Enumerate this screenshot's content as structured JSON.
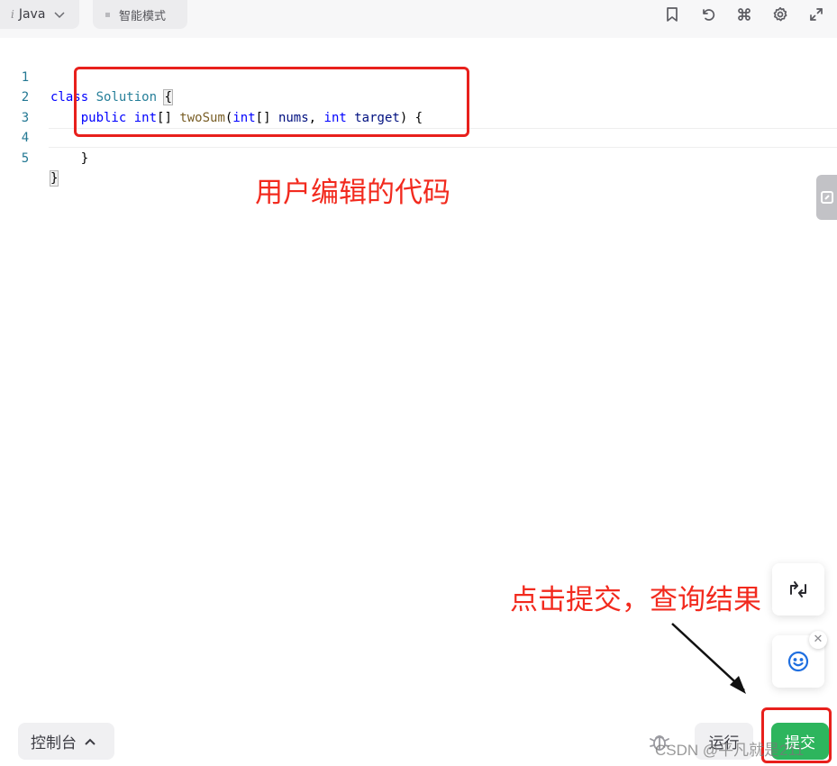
{
  "toolbar": {
    "language_icon": "i",
    "language": "Java",
    "mode": "智能模式",
    "icons": [
      "bookmark-icon",
      "reset-icon",
      "command-icon",
      "settings-icon",
      "fullscreen-icon"
    ]
  },
  "editor": {
    "lines": [
      {
        "number": "1",
        "tokens": [
          [
            "kw",
            "class"
          ],
          [
            "pl",
            " "
          ],
          [
            "ty",
            "Solution"
          ],
          [
            "pl",
            " "
          ],
          [
            "br",
            "{"
          ]
        ]
      },
      {
        "number": "2",
        "tokens": [
          [
            "pl",
            "    "
          ],
          [
            "kw",
            "public"
          ],
          [
            "pl",
            " "
          ],
          [
            "kw",
            "int"
          ],
          [
            "pl",
            "[] "
          ],
          [
            "fn",
            "twoSum"
          ],
          [
            "pl",
            "("
          ],
          [
            "kw",
            "int"
          ],
          [
            "pl",
            "[] "
          ],
          [
            "vr",
            "nums"
          ],
          [
            "pl",
            ", "
          ],
          [
            "kw",
            "int"
          ],
          [
            "pl",
            " "
          ],
          [
            "vr",
            "target"
          ],
          [
            "pl",
            ") {"
          ]
        ]
      },
      {
        "number": "3",
        "tokens": [
          [
            "pl",
            ""
          ]
        ]
      },
      {
        "number": "4",
        "tokens": [
          [
            "pl",
            "    }"
          ]
        ]
      },
      {
        "number": "5",
        "tokens": [
          [
            "br",
            "}"
          ]
        ]
      }
    ]
  },
  "annotations": {
    "code_label": "用户编辑的代码",
    "submit_label": "点击提交，查询结果",
    "color": "#f22a1e"
  },
  "bottom": {
    "console": "控制台",
    "run": "运行",
    "submit": "提交",
    "submit_color": "#2db55d",
    "watermark": "CSDN @平凡就是211"
  }
}
